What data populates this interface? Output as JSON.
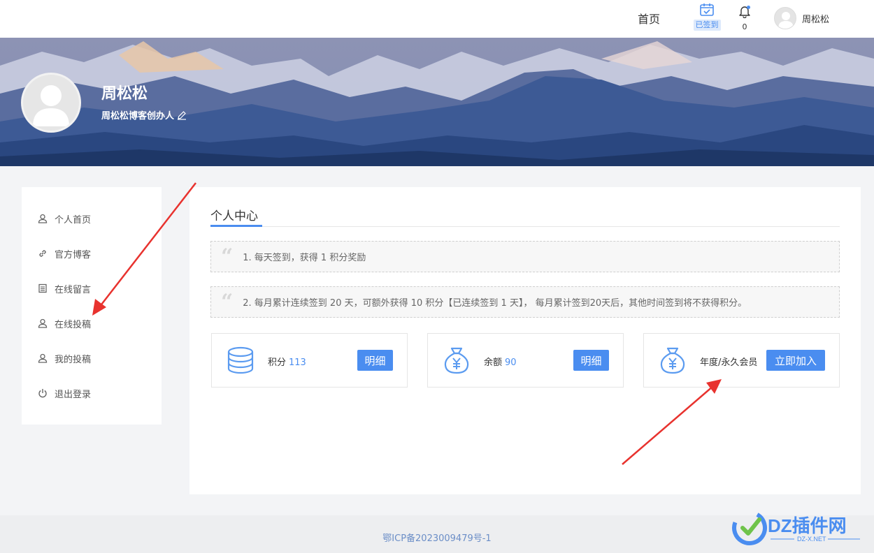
{
  "nav": {
    "home": "首页",
    "checkin": "已签到",
    "notification_count": "0",
    "username": "周松松"
  },
  "profile": {
    "name": "周松松",
    "signature": "周松松博客创办人"
  },
  "sidebar": {
    "items": [
      {
        "label": "个人首页",
        "icon": "user-icon"
      },
      {
        "label": "官方博客",
        "icon": "link-icon"
      },
      {
        "label": "在线留言",
        "icon": "list-icon"
      },
      {
        "label": "在线投稿",
        "icon": "user-icon"
      },
      {
        "label": "我的投稿",
        "icon": "user-icon"
      },
      {
        "label": "退出登录",
        "icon": "power-icon"
      }
    ]
  },
  "main": {
    "title": "个人中心",
    "notices": [
      "1. 每天签到，获得 1 积分奖励",
      "2. 每月累计连续签到 20 天，可额外获得 10 积分【已连续签到 1 天】， 每月累计签到20天后，其他时间签到将不获得积分。"
    ],
    "cards": [
      {
        "label": "积分",
        "value": "113",
        "button": "明细",
        "icon": "database-icon"
      },
      {
        "label": "余额",
        "value": "90",
        "button": "明细",
        "icon": "money-bag-icon"
      },
      {
        "label": "年度/永久会员",
        "value": "",
        "button": "立即加入",
        "icon": "money-bag-icon"
      }
    ]
  },
  "footer": {
    "icp": "鄂ICP备2023009479号-1",
    "logo_text": "DZ插件网",
    "logo_sub": "DZ-X.NET"
  },
  "colors": {
    "accent": "#4a8df0",
    "annotation_arrow": "#e8322e"
  }
}
